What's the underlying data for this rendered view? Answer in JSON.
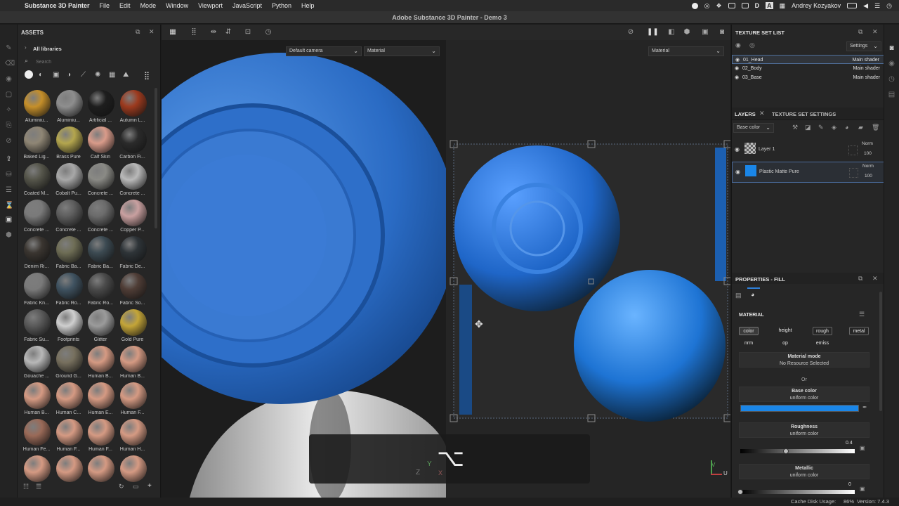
{
  "menubar": {
    "app_name": "Substance 3D Painter",
    "items": [
      "File",
      "Edit",
      "Mode",
      "Window",
      "Viewport",
      "JavaScript",
      "Python",
      "Help"
    ],
    "user": "Andrey Kozyakov"
  },
  "window_title": "Adobe Substance 3D Painter - Demo 3",
  "assets": {
    "title": "ASSETS",
    "library": "All libraries",
    "search_placeholder": "Search",
    "items": [
      {
        "label": "Aluminiu...",
        "color": "#c58f2a"
      },
      {
        "label": "Aluminiu...",
        "color": "#8e8e8e"
      },
      {
        "label": "Artificial ...",
        "color": "#1e1e1e"
      },
      {
        "label": "Autumn L...",
        "color": "#9c3a1e"
      },
      {
        "label": "Baked Lig...",
        "color": "#8f8675"
      },
      {
        "label": "Brass Pure",
        "color": "#b4a64e"
      },
      {
        "label": "Calf Skin",
        "color": "#d99b8a"
      },
      {
        "label": "Carbon Fi...",
        "color": "#2b2b2b"
      },
      {
        "label": "Coated M...",
        "color": "#55554a"
      },
      {
        "label": "Cobalt Pu...",
        "color": "#a8a8a8"
      },
      {
        "label": "Concrete ...",
        "color": "#8a8a85"
      },
      {
        "label": "Concrete ...",
        "color": "#b9b9b9"
      },
      {
        "label": "Concrete ...",
        "color": "#7a7a7a"
      },
      {
        "label": "Concrete ...",
        "color": "#5e5e5e"
      },
      {
        "label": "Concrete ...",
        "color": "#6b6b6b"
      },
      {
        "label": "Copper P...",
        "color": "#c9a0a0"
      },
      {
        "label": "Denim Ri...",
        "color": "#3a3530"
      },
      {
        "label": "Fabric Ba...",
        "color": "#6e6d55"
      },
      {
        "label": "Fabric Ba...",
        "color": "#3c4a52"
      },
      {
        "label": "Fabric De...",
        "color": "#2e3438"
      },
      {
        "label": "Fabric Kn...",
        "color": "#7a7a7a"
      },
      {
        "label": "Fabric Ro...",
        "color": "#3f5260"
      },
      {
        "label": "Fabric Ro...",
        "color": "#4a4a4a"
      },
      {
        "label": "Fabric So...",
        "color": "#4f3d36"
      },
      {
        "label": "Fabric Su...",
        "color": "#5a5a5a"
      },
      {
        "label": "Footprints",
        "color": "#cfcfcf"
      },
      {
        "label": "Glitter",
        "color": "#9b9b9b"
      },
      {
        "label": "Gold Pure",
        "color": "#c4a538"
      },
      {
        "label": "Gouache ...",
        "color": "#b8b8b8"
      },
      {
        "label": "Ground G...",
        "color": "#77705e"
      },
      {
        "label": "Human B...",
        "color": "#d59a83"
      },
      {
        "label": "Human B...",
        "color": "#d59a83"
      },
      {
        "label": "Human B...",
        "color": "#d59a83"
      },
      {
        "label": "Human C...",
        "color": "#d59a83"
      },
      {
        "label": "Human E...",
        "color": "#d59a83"
      },
      {
        "label": "Human F...",
        "color": "#d59a83"
      },
      {
        "label": "Human Fe...",
        "color": "#9a6a58"
      },
      {
        "label": "Human F...",
        "color": "#d59a83"
      },
      {
        "label": "Human F...",
        "color": "#d59a83"
      },
      {
        "label": "Human H...",
        "color": "#d59a83"
      },
      {
        "label": "",
        "color": "#d59a83"
      },
      {
        "label": "",
        "color": "#d59a83"
      },
      {
        "label": "",
        "color": "#d59a83"
      },
      {
        "label": "",
        "color": "#d59a83"
      }
    ]
  },
  "viewport": {
    "camera_dropdown": "Default camera",
    "mode_dropdown_3d": "Material",
    "mode_dropdown_2d": "Material",
    "key_overlay": "⌥",
    "axis_labels": {
      "z": "Z",
      "y": "Y",
      "x": "X",
      "u": "U",
      "v": "V"
    }
  },
  "texture_set_list": {
    "title": "TEXTURE SET LIST",
    "settings_label": "Settings",
    "sets": [
      {
        "name": "01_Head",
        "shader": "Main shader"
      },
      {
        "name": "02_Body",
        "shader": "Main shader"
      },
      {
        "name": "03_Base",
        "shader": "Main shader"
      }
    ]
  },
  "layers": {
    "tab_layers": "LAYERS",
    "tab_settings": "TEXTURE SET SETTINGS",
    "channel_dropdown": "Base color",
    "items": [
      {
        "name": "Layer 1",
        "blend": "Norm",
        "opacity": "100"
      },
      {
        "name": "Plastic Matte Pure",
        "blend": "Norm",
        "opacity": "100"
      }
    ]
  },
  "properties": {
    "title": "PROPERTIES - FILL",
    "section": "MATERIAL",
    "channels": [
      "color",
      "height",
      "rough",
      "metal",
      "nrm",
      "op",
      "emiss"
    ],
    "material_mode_label": "Material mode",
    "material_mode_value": "No Resource Selected",
    "or_label": "Or",
    "base_color_label": "Base color",
    "base_color_sub": "uniform color",
    "base_color_hex": "#1a86e8",
    "roughness_label": "Roughness",
    "roughness_sub": "uniform color",
    "roughness_value": "0.4",
    "metallic_label": "Metallic",
    "metallic_sub": "uniform color",
    "metallic_value": "0"
  },
  "statusbar": {
    "cache_label": "Cache Disk Usage:",
    "cache_value": "86%",
    "version": "Version: 7.4.3"
  }
}
